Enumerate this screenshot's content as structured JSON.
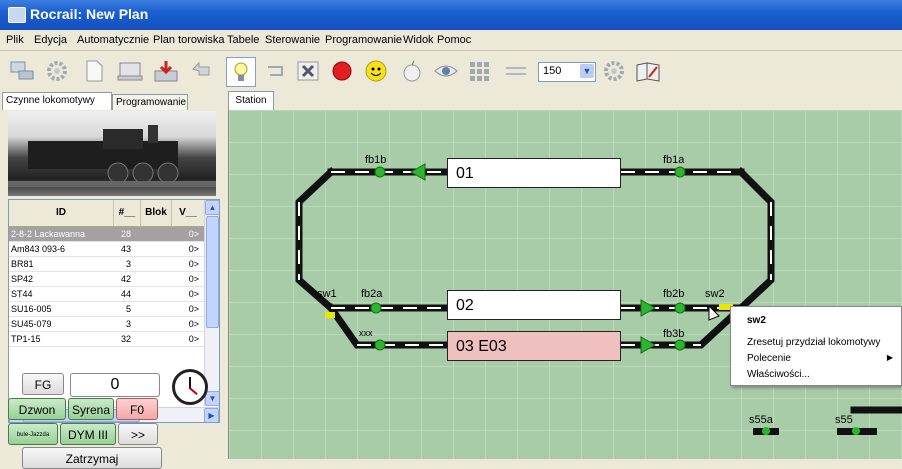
{
  "window": {
    "title": "Rocrail: New Plan"
  },
  "menu": [
    "Plik",
    "Edycja",
    "Automatycznie",
    "Plan torowiska",
    "Tabele",
    "Sterowanie",
    "Programowanie",
    "Widok",
    "Pomoc"
  ],
  "toolbar": {
    "icons": [
      "computer-icon",
      "settings-icon",
      "new-file-icon",
      "laptop-icon",
      "save-icon",
      "undo-icon",
      "lightbulb-icon",
      "loop-icon",
      "close-icon",
      "stop-icon",
      "smiley-icon",
      "apple-icon",
      "eye-icon",
      "grid-icon",
      "wave-icon",
      "zoom-select",
      "gear-icon",
      "book-icon"
    ],
    "zoom_value": "150"
  },
  "left_tabs": [
    "Czynne lokomotywy",
    "Programowanie"
  ],
  "loco_table": {
    "headers": [
      "ID",
      "#__",
      "Blok",
      "V__"
    ],
    "rows": [
      {
        "id": "2-8-2 Lackawanna",
        "num": "28",
        "v": "0>",
        "selected": true
      },
      {
        "id": "Am843 093-6",
        "num": "43",
        "v": "0>"
      },
      {
        "id": "BR81",
        "num": "3",
        "v": "0>"
      },
      {
        "id": "SP42",
        "num": "42",
        "v": "0>"
      },
      {
        "id": "ST44",
        "num": "44",
        "v": "0>"
      },
      {
        "id": "SU16-005",
        "num": "5",
        "v": "0>"
      },
      {
        "id": "SU45-079",
        "num": "3",
        "v": "0>"
      },
      {
        "id": "TP1-15",
        "num": "32",
        "v": "0>"
      }
    ],
    "hscroll_thumb": "III"
  },
  "controls": {
    "fg": "FG",
    "speed": "0",
    "dzwon": "Dzwon",
    "syrena": "Syrena",
    "f0": "F0",
    "small": "bule-Jazzda",
    "dym": "DYM III",
    "more": ">>",
    "stop": "Zatrzymaj"
  },
  "plan": {
    "tab": "Station",
    "blocks": {
      "b01": "01",
      "b02": "02",
      "b03": "03 E03"
    },
    "labels": {
      "fb1b": "fb1b",
      "fb1a": "fb1a",
      "sw1": "sw1",
      "fb2a": "fb2a",
      "fb2b": "fb2b",
      "sw2": "sw2",
      "xxx": "xxx",
      "fb3b": "fb3b",
      "s55a": "s55a",
      "s55": "s55"
    }
  },
  "context_menu": {
    "title": "sw2",
    "items": [
      "Zresetuj przydział lokomotywy",
      "Polecenie",
      "Właściwości..."
    ]
  },
  "colors": {
    "plan_bg": "#a8cba8",
    "sensor": "#2db52d",
    "block_occupied": "#f0c0c0",
    "switch_active": "#e8e800"
  }
}
